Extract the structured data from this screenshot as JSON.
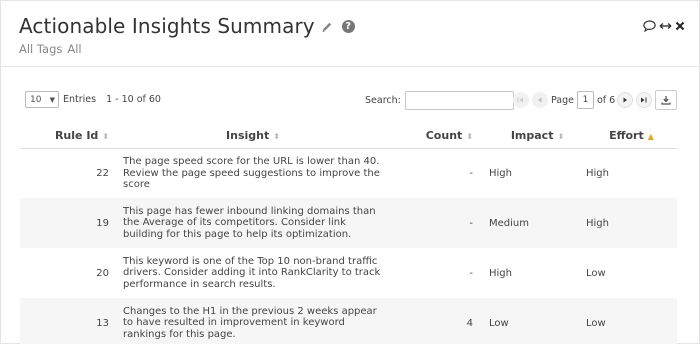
{
  "header": {
    "title": "Actionable Insights Summary",
    "tags_label": "All Tags",
    "tags_value": "All"
  },
  "toolbar": {
    "page_length": "10",
    "entries_label": "Entries",
    "range_text": "1 - 10 of 60",
    "search_label": "Search:",
    "search_value": "",
    "page_label": "Page",
    "current_page": "1",
    "of_pages": "of 6"
  },
  "table": {
    "columns": [
      "Rule Id",
      "Insight",
      "Count",
      "Impact",
      "Effort"
    ],
    "sorted_column": "Effort",
    "rows": [
      {
        "rule_id": "22",
        "insight": "The page speed score for the URL is lower than 40. Review the page speed suggestions to improve the score",
        "count": "-",
        "impact": "High",
        "effort": "High"
      },
      {
        "rule_id": "19",
        "insight": "This page has fewer inbound linking domains than the Average of its competitors. Consider link building for this page to help its optimization.",
        "count": "-",
        "impact": "Medium",
        "effort": "High"
      },
      {
        "rule_id": "20",
        "insight": "This keyword is one of the Top 10 non-brand traffic drivers. Consider adding it into RankClarity to track performance in search results.",
        "count": "-",
        "impact": "High",
        "effort": "Low"
      },
      {
        "rule_id": "13",
        "insight": "Changes to the H1 in the previous 2 weeks appear to have resulted in improvement in keyword rankings for this page.",
        "count": "4",
        "impact": "Low",
        "effort": "Low"
      }
    ]
  },
  "colors": {
    "accent_sort": "#f0a30a",
    "row_stripe": "#f6f6f6"
  },
  "icons": [
    "pencil-icon",
    "help-icon",
    "comment-icon",
    "resize-arrows-icon",
    "close-icon",
    "first-page-icon",
    "prev-page-icon",
    "next-page-icon",
    "last-page-icon",
    "download-icon"
  ]
}
